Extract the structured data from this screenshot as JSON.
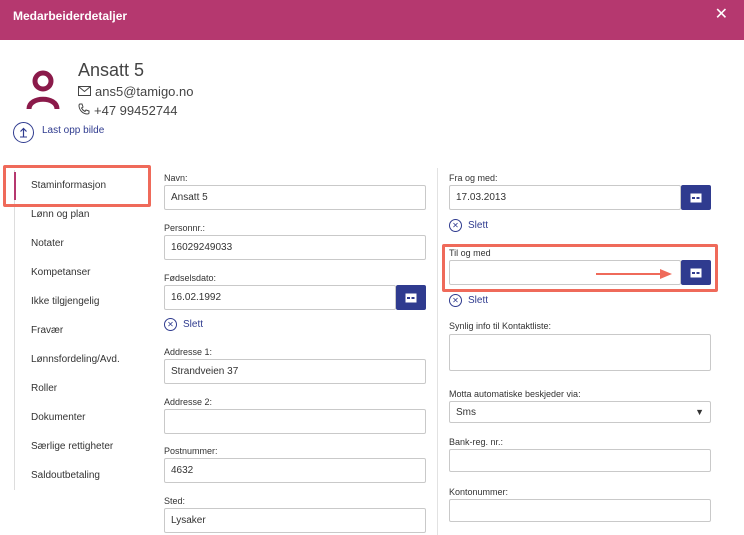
{
  "dialog": {
    "title": "Medarbeiderdetaljer",
    "close_icon": "close-icon"
  },
  "employee": {
    "name": "Ansatt 5",
    "email": "ans5@tamigo.no",
    "phone": "+47 99452744",
    "upload_label": "Last opp bilde"
  },
  "sidebar": {
    "items": [
      {
        "label": "Staminformasjon",
        "active": true
      },
      {
        "label": "Lønn og plan"
      },
      {
        "label": "Notater"
      },
      {
        "label": "Kompetanser"
      },
      {
        "label": "Ikke tilgjengelig"
      },
      {
        "label": "Fravær"
      },
      {
        "label": "Lønnsfordeling/Avd."
      },
      {
        "label": "Roller"
      },
      {
        "label": "Dokumenter"
      },
      {
        "label": "Særlige rettigheter"
      },
      {
        "label": "Saldoutbetaling"
      }
    ]
  },
  "form_left": {
    "name_label": "Navn:",
    "name_value": "Ansatt 5",
    "personnr_label": "Personnr.:",
    "personnr_value": "16029249033",
    "dob_label": "Fødselsdato:",
    "dob_value": "16.02.1992",
    "dob_delete": "Slett",
    "address1_label": "Addresse 1:",
    "address1_value": "Strandveien 37",
    "address2_label": "Addresse 2:",
    "address2_value": "",
    "postnr_label": "Postnummer:",
    "postnr_value": "4632",
    "sted_label": "Sted:",
    "sted_value": "Lysaker"
  },
  "form_right": {
    "from_label": "Fra og med:",
    "from_value": "17.03.2013",
    "from_delete": "Slett",
    "to_label": "Til og med",
    "to_value": "",
    "to_delete": "Slett",
    "visible_info_label": "Synlig info til Kontaktliste:",
    "visible_info_value": "",
    "auto_msg_label": "Motta automatiske beskjeder via:",
    "auto_msg_value": "Sms",
    "bank_label": "Bank-reg. nr.:",
    "bank_value": "",
    "account_label": "Kontonummer:",
    "account_value": ""
  },
  "colors": {
    "header": "#b5386f",
    "accent": "#2f3b8f",
    "highlight": "#ef6a5a",
    "avatar": "#8b1a4a"
  }
}
